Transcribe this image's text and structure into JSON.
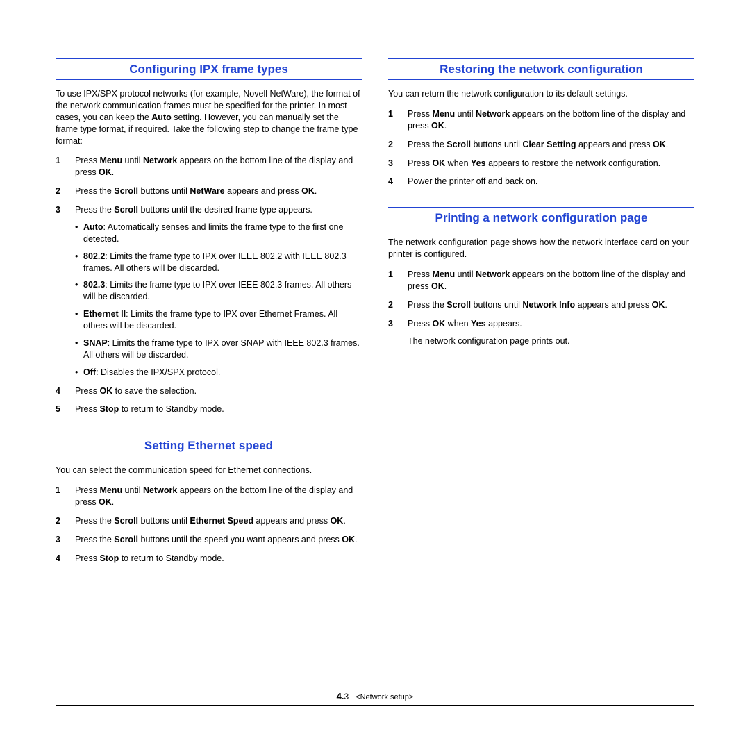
{
  "left": {
    "s1": {
      "title": "Configuring IPX frame types",
      "intro_parts": [
        "To use IPX/SPX protocol networks (for example, Novell NetWare), the format of the network communication frames must be specified for the printer. In most cases, you can keep the ",
        "Auto",
        " setting. However, you can manually set the frame type format, if required. Take the following step to change the frame type format:"
      ],
      "steps": [
        {
          "parts": [
            "Press ",
            "Menu",
            " until ",
            "Network",
            " appears on the bottom line of the display and press ",
            "OK",
            "."
          ]
        },
        {
          "parts": [
            "Press the ",
            "Scroll",
            " buttons until ",
            "NetWare",
            " appears and press ",
            "OK",
            "."
          ]
        },
        {
          "parts": [
            "Press the ",
            "Scroll",
            " buttons until the desired frame type appears."
          ],
          "subs": [
            {
              "b": "Auto",
              "t": ": Automatically senses and limits the frame type to the first one detected."
            },
            {
              "b": "802.2",
              "t": ": Limits the frame type to IPX over IEEE 802.2 with IEEE 802.3 frames. All others will be discarded."
            },
            {
              "b": "802.3",
              "t": ": Limits the frame type to IPX over IEEE 802.3 frames. All others will be discarded."
            },
            {
              "b": "Ethernet II",
              "t": ": Limits the frame type to IPX over Ethernet Frames. All others will be discarded."
            },
            {
              "b": "SNAP",
              "t": ": Limits the frame type to IPX over SNAP with IEEE 802.3 frames. All others will be discarded."
            },
            {
              "b": "Off",
              "t": ": Disables the IPX/SPX protocol."
            }
          ]
        },
        {
          "parts": [
            "Press ",
            "OK",
            " to save the selection."
          ]
        },
        {
          "parts": [
            "Press ",
            "Stop",
            " to return to Standby mode."
          ]
        }
      ]
    },
    "s2": {
      "title": "Setting Ethernet speed",
      "intro": "You can select the communication speed for Ethernet connections.",
      "steps": [
        {
          "parts": [
            "Press ",
            "Menu",
            " until ",
            "Network",
            " appears on the bottom line of the display and press ",
            "OK",
            "."
          ]
        },
        {
          "parts": [
            "Press the ",
            "Scroll",
            " buttons until ",
            "Ethernet Speed",
            " appears and press ",
            "OK",
            "."
          ]
        },
        {
          "parts": [
            "Press the ",
            "Scroll",
            " buttons until the speed you want appears and press ",
            "OK",
            "."
          ]
        },
        {
          "parts": [
            "Press ",
            "Stop",
            " to return to Standby mode."
          ]
        }
      ]
    }
  },
  "right": {
    "s1": {
      "title": "Restoring the network configuration",
      "intro": "You can return the network configuration to its default settings.",
      "steps": [
        {
          "parts": [
            "Press ",
            "Menu",
            " until ",
            "Network",
            " appears on the bottom line of the display and press ",
            "OK",
            "."
          ]
        },
        {
          "parts": [
            "Press the ",
            "Scroll",
            " buttons until ",
            "Clear Setting",
            " appears and press ",
            "OK",
            "."
          ]
        },
        {
          "parts": [
            "Press ",
            "OK",
            " when ",
            "Yes",
            " appears to restore the network configuration."
          ]
        },
        {
          "parts": [
            "Power the printer off and back on."
          ]
        }
      ]
    },
    "s2": {
      "title": "Printing a network configuration page",
      "intro": "The network configuration page shows how the network interface card on your printer is configured.",
      "steps": [
        {
          "parts": [
            "Press ",
            "Menu",
            " until ",
            "Network",
            " appears on the bottom line of the display and press ",
            "OK",
            "."
          ]
        },
        {
          "parts": [
            "Press the ",
            "Scroll",
            " buttons until ",
            "Network Info",
            " appears and press ",
            "OK",
            "."
          ]
        },
        {
          "parts": [
            "Press ",
            "OK",
            " when ",
            "Yes",
            " appears."
          ]
        }
      ],
      "trailing": "The network configuration page prints out."
    }
  },
  "footer": {
    "page": "4.",
    "num": "3",
    "chapter": "<Network setup>"
  }
}
